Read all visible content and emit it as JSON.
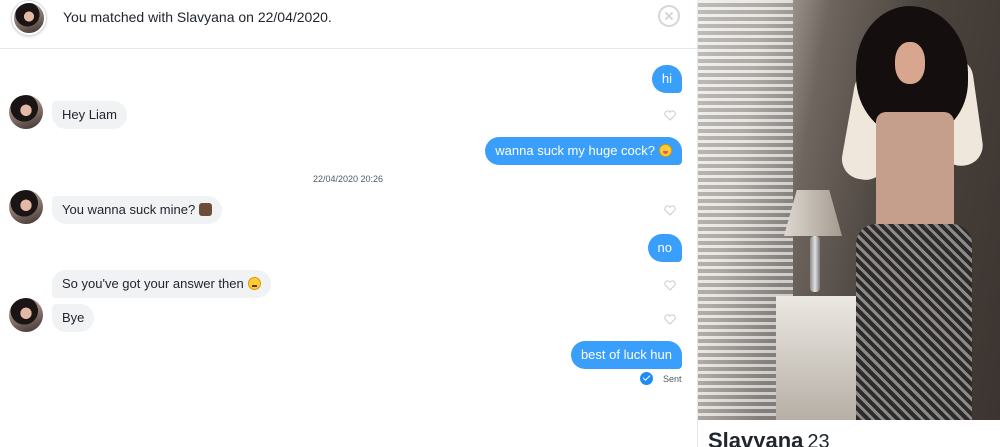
{
  "header": {
    "match_text": "You matched with Slavyana on 22/04/2020."
  },
  "conversation": {
    "timestamp": "22/04/2020 20:26",
    "messages": [
      {
        "side": "out",
        "text": "hi"
      },
      {
        "side": "in",
        "text": "Hey Liam"
      },
      {
        "side": "out",
        "text": "wanna suck my huge cock?",
        "emoji": "tongue-face-emoji"
      },
      {
        "side": "in",
        "text": "You wanna suck mine?",
        "emoji": "woman-facepalm-emoji"
      },
      {
        "side": "out",
        "text": "no"
      },
      {
        "side": "in",
        "text": "So you've got your answer then",
        "emoji": "angry-face-emoji"
      },
      {
        "side": "in",
        "text": "Bye"
      },
      {
        "side": "out",
        "text": "best of luck hun"
      }
    ],
    "status": "Sent"
  },
  "profile": {
    "name": "Slavyana",
    "age": "23"
  }
}
